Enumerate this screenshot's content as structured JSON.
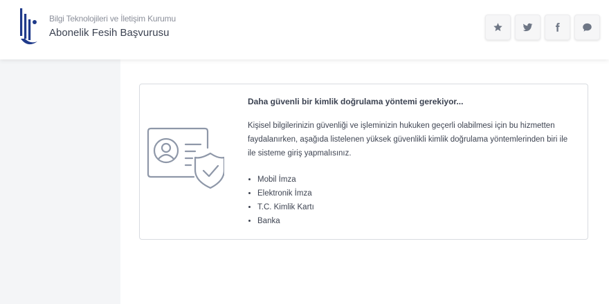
{
  "header": {
    "org_name": "Bilgi Teknolojileri ve İletişim Kurumu",
    "app_title": "Abonelik Fesih Başvurusu",
    "logo_color": "#1f3a8a",
    "social_buttons": [
      {
        "icon": "star-icon"
      },
      {
        "icon": "twitter-icon"
      },
      {
        "icon": "facebook-icon"
      },
      {
        "icon": "chat-icon"
      }
    ]
  },
  "card": {
    "title": "Daha güvenli bir kimlik doğrulama yöntemi gerekiyor...",
    "description": "Kişisel bilgilerinizin güvenliği ve işleminizin hukuken geçerli olabilmesi için bu hizmetten faydalanırken, aşağıda listelenen yüksek güvenlikli kimlik doğrulama yöntemlerinden biri ile ile sisteme giriş yapmalısınız.",
    "methods": [
      "Mobil İmza",
      "Elektronik İmza",
      "T.C. Kimlik Kartı",
      "Banka"
    ],
    "illustration": "id-card-shield-icon"
  },
  "colors": {
    "accent": "#1f3a8a",
    "icon_gray": "#6e7685",
    "illustration": "#8e97a8",
    "sidebar_bg": "#f4f5f7"
  }
}
